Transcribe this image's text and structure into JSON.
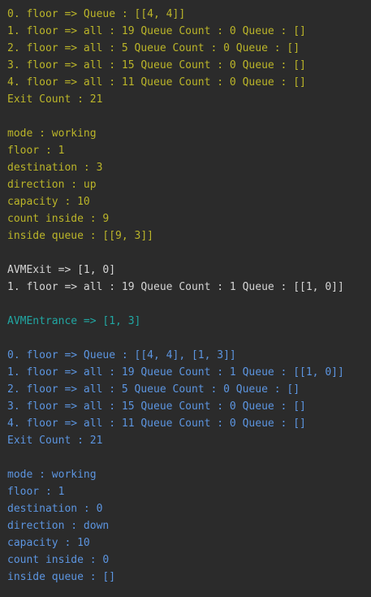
{
  "colors": {
    "background": "#2b2b2b",
    "yellow": "#bbb529",
    "white": "#d4d4d4",
    "teal": "#21a7a3",
    "blue": "#5c95e0"
  },
  "console": {
    "lines": [
      {
        "color": "yellow",
        "text": "0. floor => Queue : [[4, 4]]"
      },
      {
        "color": "yellow",
        "text": "1. floor => all : 19 Queue Count : 0 Queue : []"
      },
      {
        "color": "yellow",
        "text": "2. floor => all : 5 Queue Count : 0 Queue : []"
      },
      {
        "color": "yellow",
        "text": "3. floor => all : 15 Queue Count : 0 Queue : []"
      },
      {
        "color": "yellow",
        "text": "4. floor => all : 11 Queue Count : 0 Queue : []"
      },
      {
        "color": "yellow",
        "text": "Exit Count : 21"
      },
      {
        "color": "yellow",
        "text": ""
      },
      {
        "color": "yellow",
        "text": "mode : working"
      },
      {
        "color": "yellow",
        "text": "floor : 1"
      },
      {
        "color": "yellow",
        "text": "destination : 3"
      },
      {
        "color": "yellow",
        "text": "direction : up"
      },
      {
        "color": "yellow",
        "text": "capacity : 10"
      },
      {
        "color": "yellow",
        "text": "count inside : 9"
      },
      {
        "color": "yellow",
        "text": "inside queue : [[9, 3]]"
      },
      {
        "color": "yellow",
        "text": ""
      },
      {
        "color": "white",
        "text": "AVMExit => [1, 0]"
      },
      {
        "color": "white",
        "text": "1. floor => all : 19 Queue Count : 1 Queue : [[1, 0]]"
      },
      {
        "color": "white",
        "text": ""
      },
      {
        "color": "teal",
        "text": "AVMEntrance => [1, 3]"
      },
      {
        "color": "teal",
        "text": ""
      },
      {
        "color": "blue",
        "text": "0. floor => Queue : [[4, 4], [1, 3]]"
      },
      {
        "color": "blue",
        "text": "1. floor => all : 19 Queue Count : 1 Queue : [[1, 0]]"
      },
      {
        "color": "blue",
        "text": "2. floor => all : 5 Queue Count : 0 Queue : []"
      },
      {
        "color": "blue",
        "text": "3. floor => all : 15 Queue Count : 0 Queue : []"
      },
      {
        "color": "blue",
        "text": "4. floor => all : 11 Queue Count : 0 Queue : []"
      },
      {
        "color": "blue",
        "text": "Exit Count : 21"
      },
      {
        "color": "blue",
        "text": ""
      },
      {
        "color": "blue",
        "text": "mode : working"
      },
      {
        "color": "blue",
        "text": "floor : 1"
      },
      {
        "color": "blue",
        "text": "destination : 0"
      },
      {
        "color": "blue",
        "text": "direction : down"
      },
      {
        "color": "blue",
        "text": "capacity : 10"
      },
      {
        "color": "blue",
        "text": "count inside : 0"
      },
      {
        "color": "blue",
        "text": "inside queue : []"
      }
    ]
  }
}
